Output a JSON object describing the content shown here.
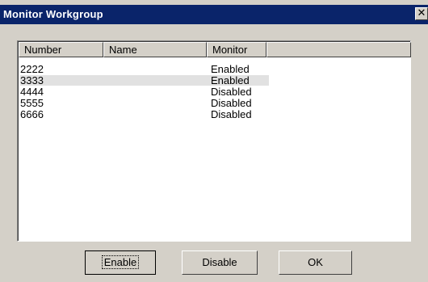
{
  "window": {
    "title": "Monitor Workgroup",
    "close_glyph": "✕"
  },
  "list": {
    "columns": [
      "Number",
      "Name",
      "Monitor",
      ""
    ],
    "rows": [
      {
        "number": "2222",
        "name": "",
        "monitor": "Enabled",
        "selected": false
      },
      {
        "number": "3333",
        "name": "",
        "monitor": "Enabled",
        "selected": true
      },
      {
        "number": "4444",
        "name": "",
        "monitor": "Disabled",
        "selected": false
      },
      {
        "number": "5555",
        "name": "",
        "monitor": "Disabled",
        "selected": false
      },
      {
        "number": "6666",
        "name": "",
        "monitor": "Disabled",
        "selected": false
      }
    ]
  },
  "buttons": {
    "enable": "Enable",
    "disable": "Disable",
    "ok": "OK"
  }
}
